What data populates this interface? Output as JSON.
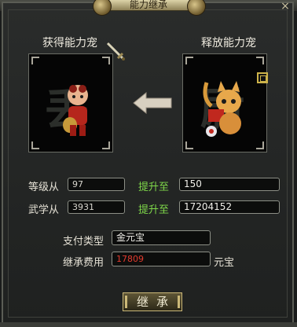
{
  "window": {
    "title": "能力继承",
    "close_label": "×"
  },
  "source_panel": {
    "title": "获得能力宠",
    "watermark": "丢"
  },
  "target_panel": {
    "title": "释放能力宠",
    "watermark": "尉"
  },
  "level": {
    "label": "等级从",
    "from_value": "97",
    "to_label": "提升至",
    "to_value": "150"
  },
  "martial": {
    "label": "武学从",
    "from_value": "3931",
    "to_label": "提升至",
    "to_value": "17204152"
  },
  "payment": {
    "label": "支付类型",
    "value": "金元宝"
  },
  "cost": {
    "label": "继承费用",
    "value": "17809",
    "unit": "元宝"
  },
  "confirm_button": "继承",
  "colors": {
    "accent_green": "#7fd84a",
    "cost_red": "#e23b2e",
    "gold": "#cbb878"
  }
}
